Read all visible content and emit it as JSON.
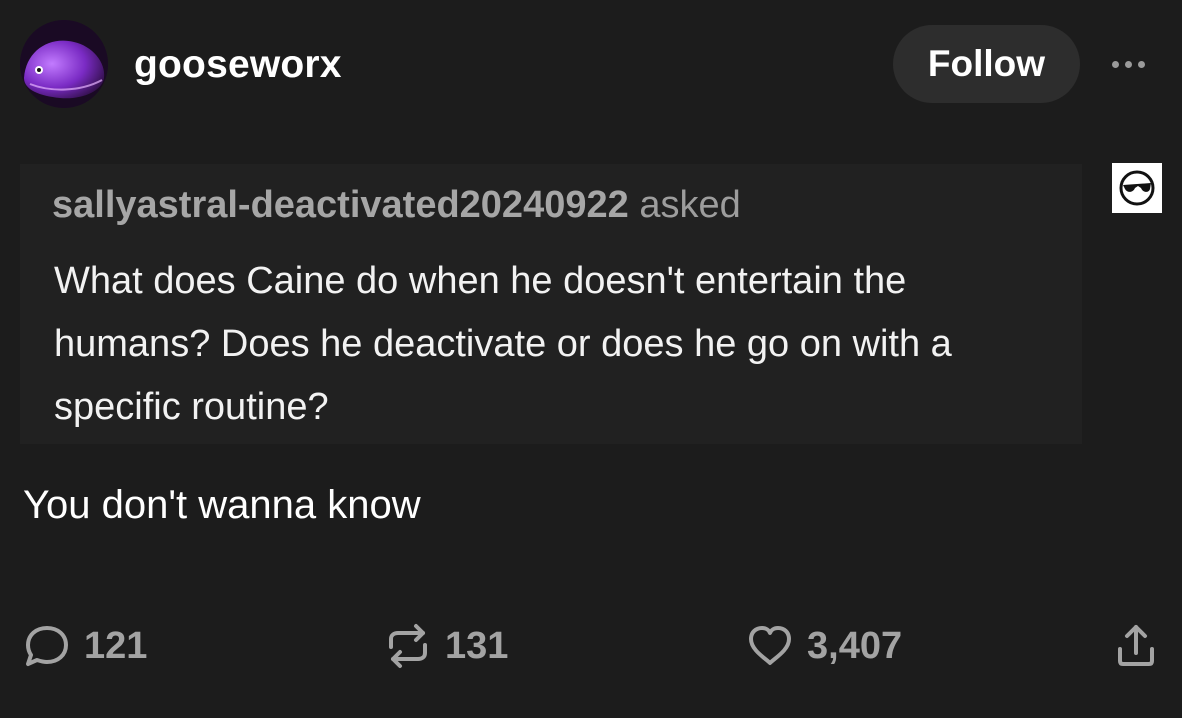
{
  "header": {
    "username": "gooseworx",
    "follow_label": "Follow",
    "more_icon": "more-horizontal-icon"
  },
  "ask": {
    "asker": "sallyastral-deactivated20240922",
    "asked_word": "asked",
    "question": "What does Caine do when he doesn't entertain the humans? Does he deactivate or does he go on with a specific routine?",
    "anon_icon": "sunglasses-face-icon"
  },
  "answer": {
    "text": "You don't wanna know"
  },
  "actions": {
    "replies": "121",
    "reblogs": "131",
    "likes": "3,407",
    "share_icon": "share-icon"
  },
  "colors": {
    "background": "#1c1c1c",
    "ask_background": "#212121",
    "follow_button": "#2d2d2d",
    "muted_text": "#a3a3a3"
  }
}
